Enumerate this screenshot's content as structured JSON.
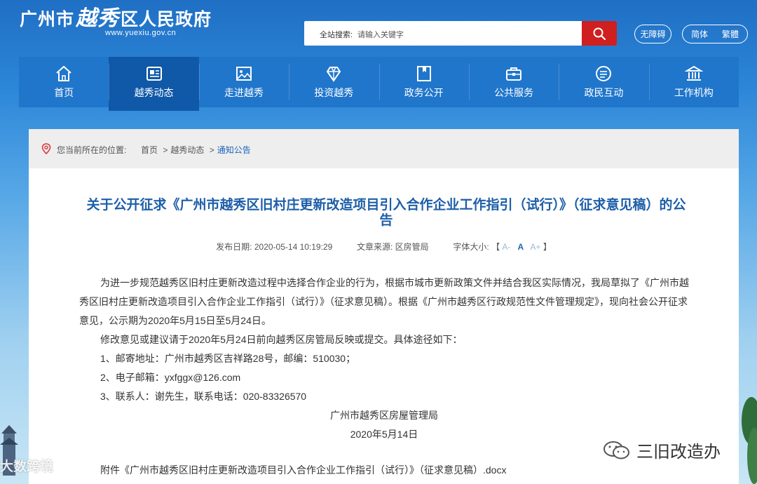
{
  "header": {
    "site_prefix": "广州市",
    "site_calli": "越秀",
    "site_suffix": "区人民政府",
    "site_url": "www.yuexiu.gov.cn",
    "search_label": "全站搜索:",
    "search_placeholder": "请输入关键字",
    "accessibility": "无障碍",
    "lang_simplified": "简体",
    "lang_traditional": "繁體"
  },
  "nav": {
    "items": [
      {
        "label": "首页",
        "icon": "home-icon"
      },
      {
        "label": "越秀动态",
        "icon": "newspaper-icon",
        "active": true
      },
      {
        "label": "走进越秀",
        "icon": "picture-icon"
      },
      {
        "label": "投资越秀",
        "icon": "diamond-icon"
      },
      {
        "label": "政务公开",
        "icon": "bookmark-icon"
      },
      {
        "label": "公共服务",
        "icon": "briefcase-icon"
      },
      {
        "label": "政民互动",
        "icon": "chat-icon"
      },
      {
        "label": "工作机构",
        "icon": "building-icon"
      }
    ]
  },
  "breadcrumb": {
    "label": "您当前所在的位置:",
    "items": [
      "首页",
      "越秀动态",
      "通知公告"
    ]
  },
  "article": {
    "title": "关于公开征求《广州市越秀区旧村庄更新改造项目引入合作企业工作指引（试行）》（征求意见稿）的公告",
    "publish_label": "发布日期:",
    "publish_date": "2020-05-14 10:19:29",
    "source_label": "文章来源:",
    "source": "区房管局",
    "font_label": "字体大小:",
    "bracket_open": "【",
    "bracket_close": "】",
    "font_small": "A-",
    "font_medium": "A",
    "font_large": "A+",
    "paragraphs": [
      "为进一步规范越秀区旧村庄更新改造过程中选择合作企业的行为，根据市城市更新政策文件并结合我区实际情况，我局草拟了《广州市越秀区旧村庄更新改造项目引入合作企业工作指引（试行）》（征求意见稿）。根据《广州市越秀区行政规范性文件管理规定》，现向社会公开征求意见，公示期为2020年5月15日至5月24日。",
      "修改意见或建议请于2020年5月24日前向越秀区房管局反映或提交。具体途径如下：",
      "1、邮寄地址：广州市越秀区吉祥路28号，邮编：510030；",
      "2、电子邮箱：yxfggx@126.com",
      "3、联系人：谢先生，联系电话：020-83326570"
    ],
    "signature": "广州市越秀区房屋管理局",
    "date": "2020年5月14日",
    "attachment": "附件《广州市越秀区旧村庄更新改造项目引入合作企业工作指引（试行）》（征求意见稿）.docx"
  },
  "watermarks": {
    "left": "大数跨境",
    "right": "三旧改造办"
  },
  "colors": {
    "nav_bg": "#2076cb",
    "nav_active": "#1058a8",
    "title": "#1d5ea8",
    "search_button": "#cf1f1f"
  }
}
